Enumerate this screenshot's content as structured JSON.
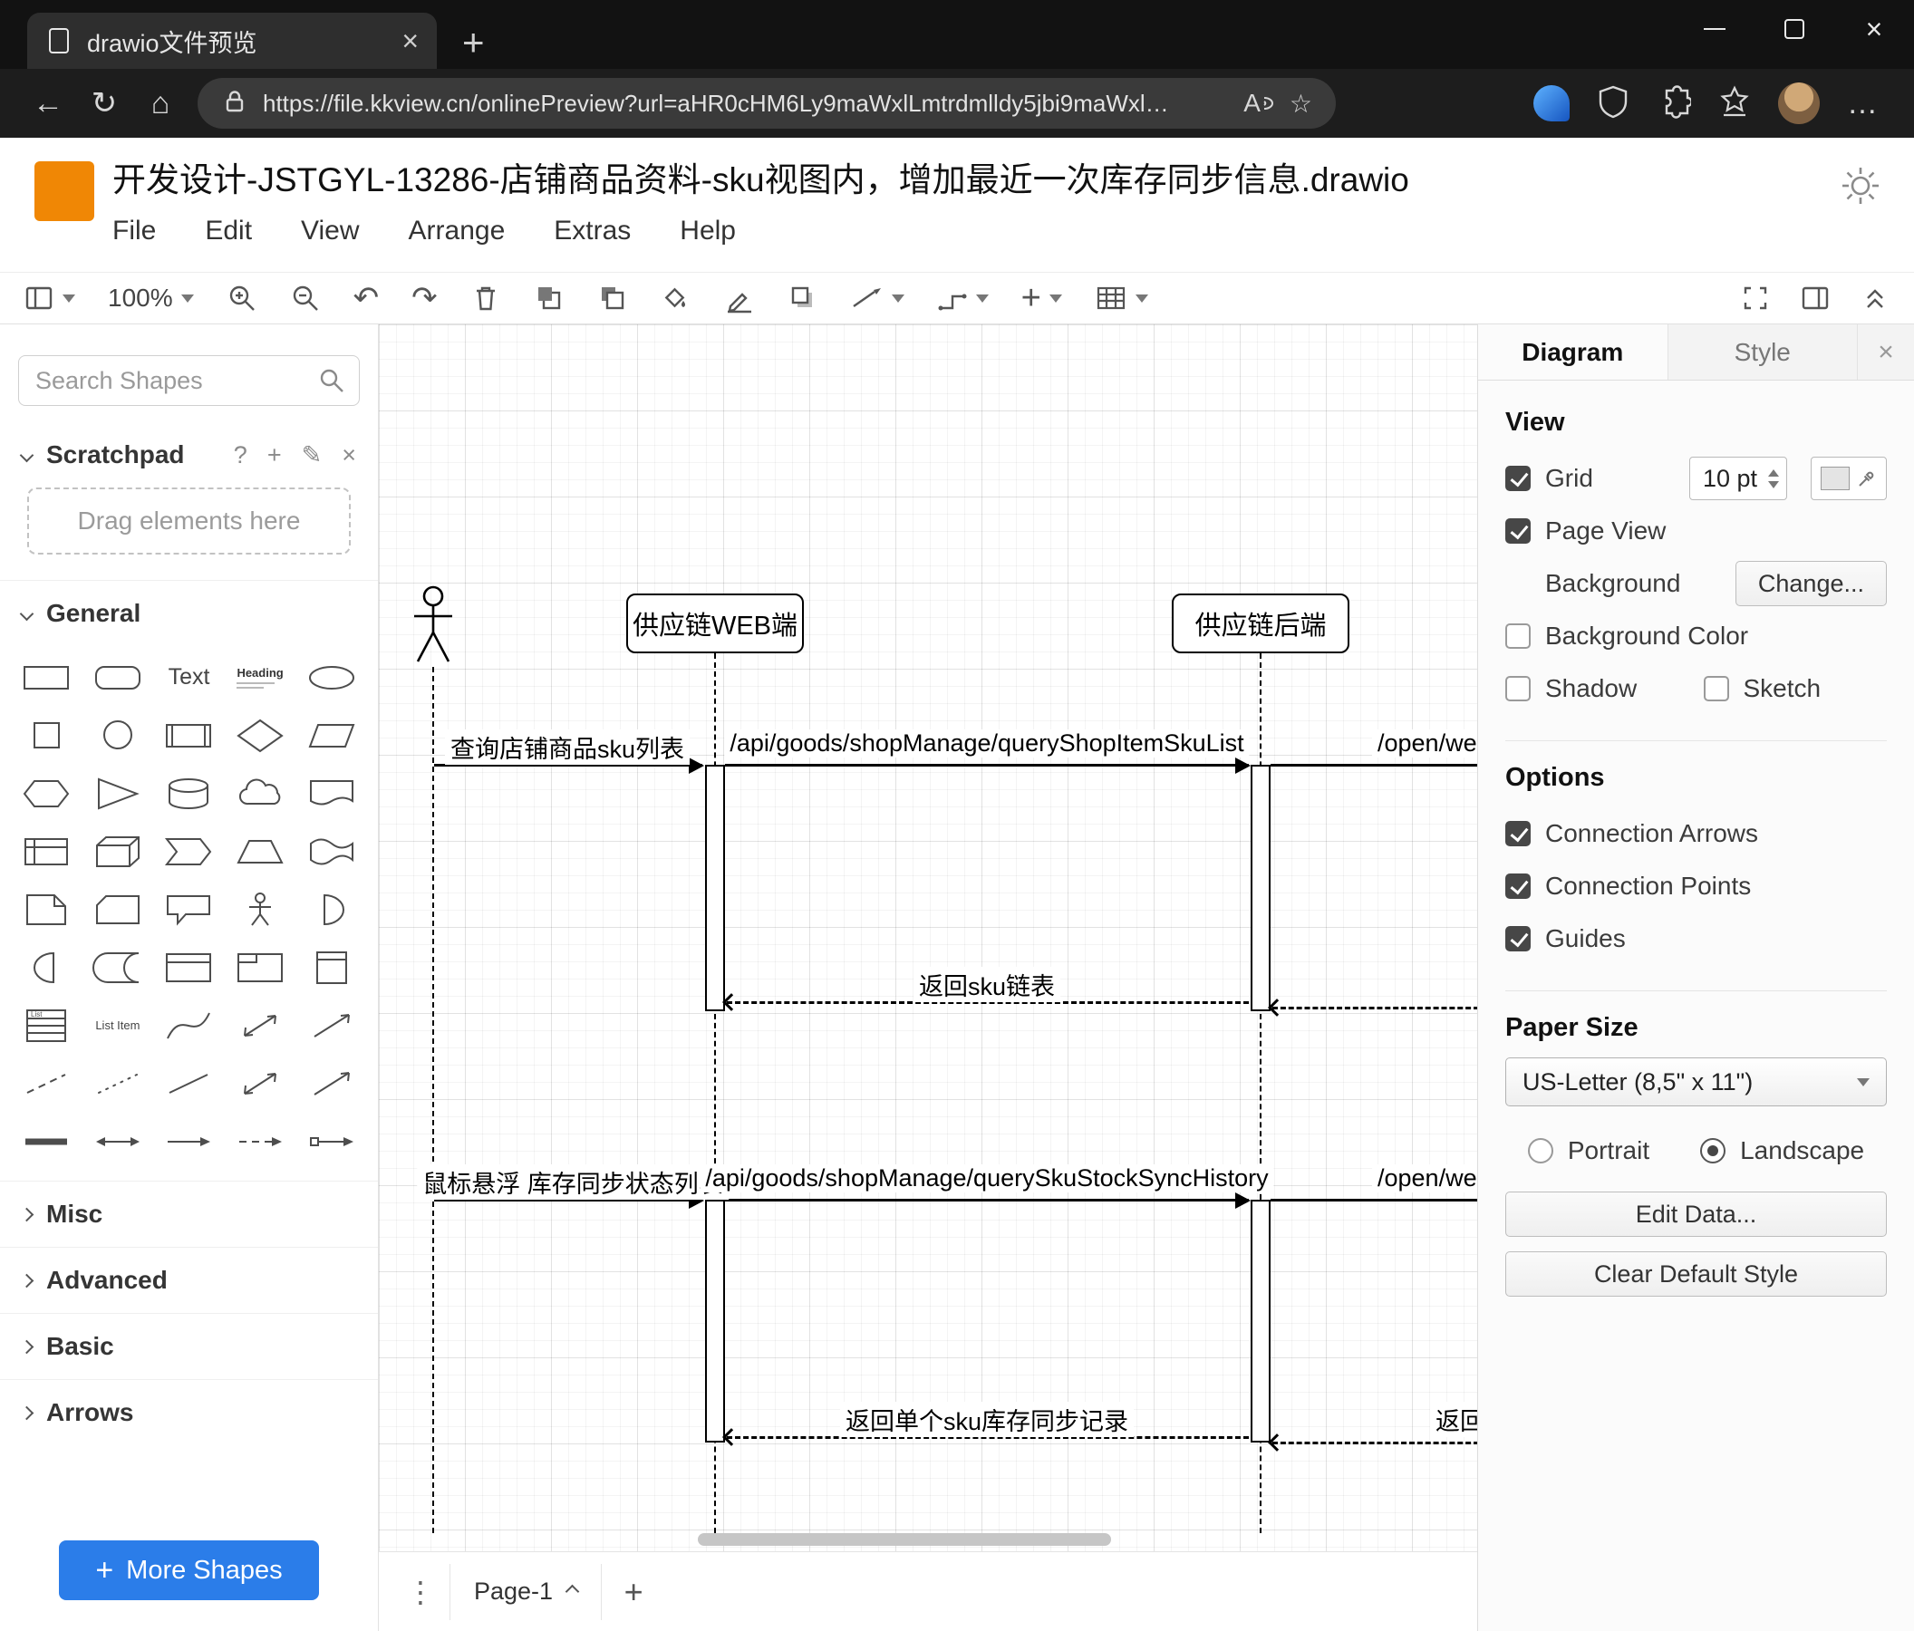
{
  "icons": {
    "close": "×",
    "plus": "+",
    "back": "←",
    "refresh": "↻",
    "home": "⌂",
    "ellipsis": "…",
    "star": "☆",
    "dots": "⋮",
    "question": "?",
    "pencil": "✎",
    "undo": "↶",
    "redo": "↷"
  },
  "browser": {
    "tab_title": "drawio文件预览",
    "url": "https://file.kkview.cn/onlinePreview?url=aHR0cHM6Ly9maWxlLmtrdmlldy5jbi9maWxl…",
    "read_aloud": "A"
  },
  "app": {
    "title": "开发设计-JSTGYL-13286-店铺商品资料-sku视图内，增加最近一次库存同步信息.drawio",
    "logo_color": "#F08705",
    "menus": [
      "File",
      "Edit",
      "View",
      "Arrange",
      "Extras",
      "Help"
    ]
  },
  "toolbar": {
    "zoom": "100%"
  },
  "sidebar": {
    "search_placeholder": "Search Shapes",
    "scratchpad_label": "Scratchpad",
    "drop_hint": "Drag elements here",
    "section_general": "General",
    "collapsed_sections": [
      "Misc",
      "Advanced",
      "Basic",
      "Arrows"
    ],
    "more_shapes": "More Shapes",
    "accent": "#2b7de9",
    "shape_text_label": "Text",
    "shape_heading_label": "Heading",
    "shape_list_label": "List",
    "shape_list_item_label": "List Item",
    "shapes": [
      "rectangle",
      "rounded-rectangle",
      "text",
      "heading",
      "ellipse",
      "square",
      "circle",
      "process",
      "diamond",
      "parallelogram",
      "hexagon",
      "triangle",
      "cylinder",
      "cloud",
      "document",
      "internal-storage",
      "cube",
      "step",
      "trapezoid",
      "tape",
      "note",
      "card",
      "callout",
      "actor",
      "or",
      "and",
      "data-storage",
      "container",
      "container-title",
      "vertical-container",
      "list",
      "list-item",
      "curve",
      "bidirectional-arrow",
      "arrow",
      "dashed-line",
      "dotted-line",
      "line",
      "bidirectional-connector",
      "directional-connector",
      "link",
      "double-arrow",
      "arrow-connector",
      "dashed-connector",
      "labeled-arrow"
    ]
  },
  "canvas": {
    "page_tab": "Page-1",
    "diagram": {
      "lifeline_web": "供应链WEB端",
      "lifeline_backend": "供应链后端",
      "msg1_label": "查询店铺商品sku列表",
      "msg1_api": "/api/goods/shopManage/queryShopItemSkuList",
      "msg1_open_api": "/open/webapi/",
      "return1_label": "返回sku链表",
      "msg2_label": "鼠标悬浮 库存同步状态列表",
      "msg2_api": "/api/goods/shopManage/querySkuStockSyncHistory",
      "msg2_open_api": "/open/webapi/iten",
      "return2_label": "返回单个sku库存同步记录",
      "return2_right_label": "返回"
    }
  },
  "format": {
    "tab_diagram": "Diagram",
    "tab_style": "Style",
    "view_heading": "View",
    "grid_label": "Grid",
    "grid_size": "10 pt",
    "grid_checked": true,
    "page_view_label": "Page View",
    "page_view_checked": true,
    "background_label": "Background",
    "change_button": "Change...",
    "background_color_label": "Background Color",
    "background_color_checked": false,
    "shadow_label": "Shadow",
    "shadow_checked": false,
    "sketch_label": "Sketch",
    "sketch_checked": false,
    "options_heading": "Options",
    "opt_connection_arrows": "Connection Arrows",
    "opt_connection_arrows_checked": true,
    "opt_connection_points": "Connection Points",
    "opt_connection_points_checked": true,
    "opt_guides": "Guides",
    "opt_guides_checked": true,
    "paper_heading": "Paper Size",
    "paper_size": "US-Letter (8,5\" x 11\")",
    "portrait_label": "Portrait",
    "landscape_label": "Landscape",
    "landscape_selected": true,
    "edit_data_button": "Edit Data...",
    "clear_style_button": "Clear Default Style"
  }
}
